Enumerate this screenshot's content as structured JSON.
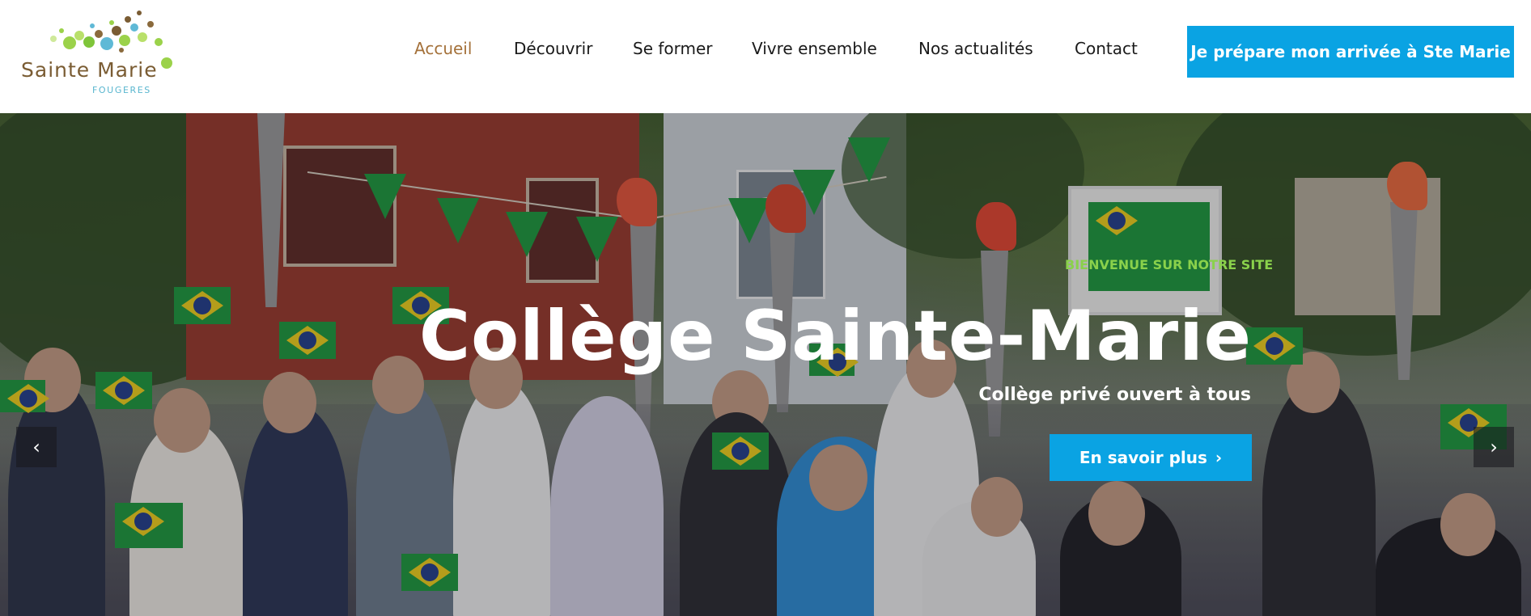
{
  "logo": {
    "name": "Sainte Marie",
    "subtitle": "FOUGERES"
  },
  "nav": {
    "items": [
      {
        "label": "Accueil",
        "active": true
      },
      {
        "label": "Découvrir",
        "active": false
      },
      {
        "label": "Se former",
        "active": false
      },
      {
        "label": "Vivre ensemble",
        "active": false
      },
      {
        "label": "Nos actualités",
        "active": false
      },
      {
        "label": "Contact",
        "active": false
      }
    ],
    "cta_label": "Je prépare mon arrivée à Ste Marie"
  },
  "hero": {
    "eyebrow": "BIENVENUE SUR NOTRE SITE",
    "title": "Collège Sainte-Marie",
    "subtitle": "Collège privé ouvert à tous",
    "button_label": "En savoir plus",
    "button_icon": "chevron-right-icon",
    "prev_icon": "chevron-left-icon",
    "next_icon": "chevron-right-icon"
  },
  "colors": {
    "accent": "#0aa3e3",
    "nav_active": "#a4713a",
    "eyebrow": "#8ad14b",
    "logo_brown": "#7a5c33",
    "logo_blue": "#59b6cf"
  }
}
